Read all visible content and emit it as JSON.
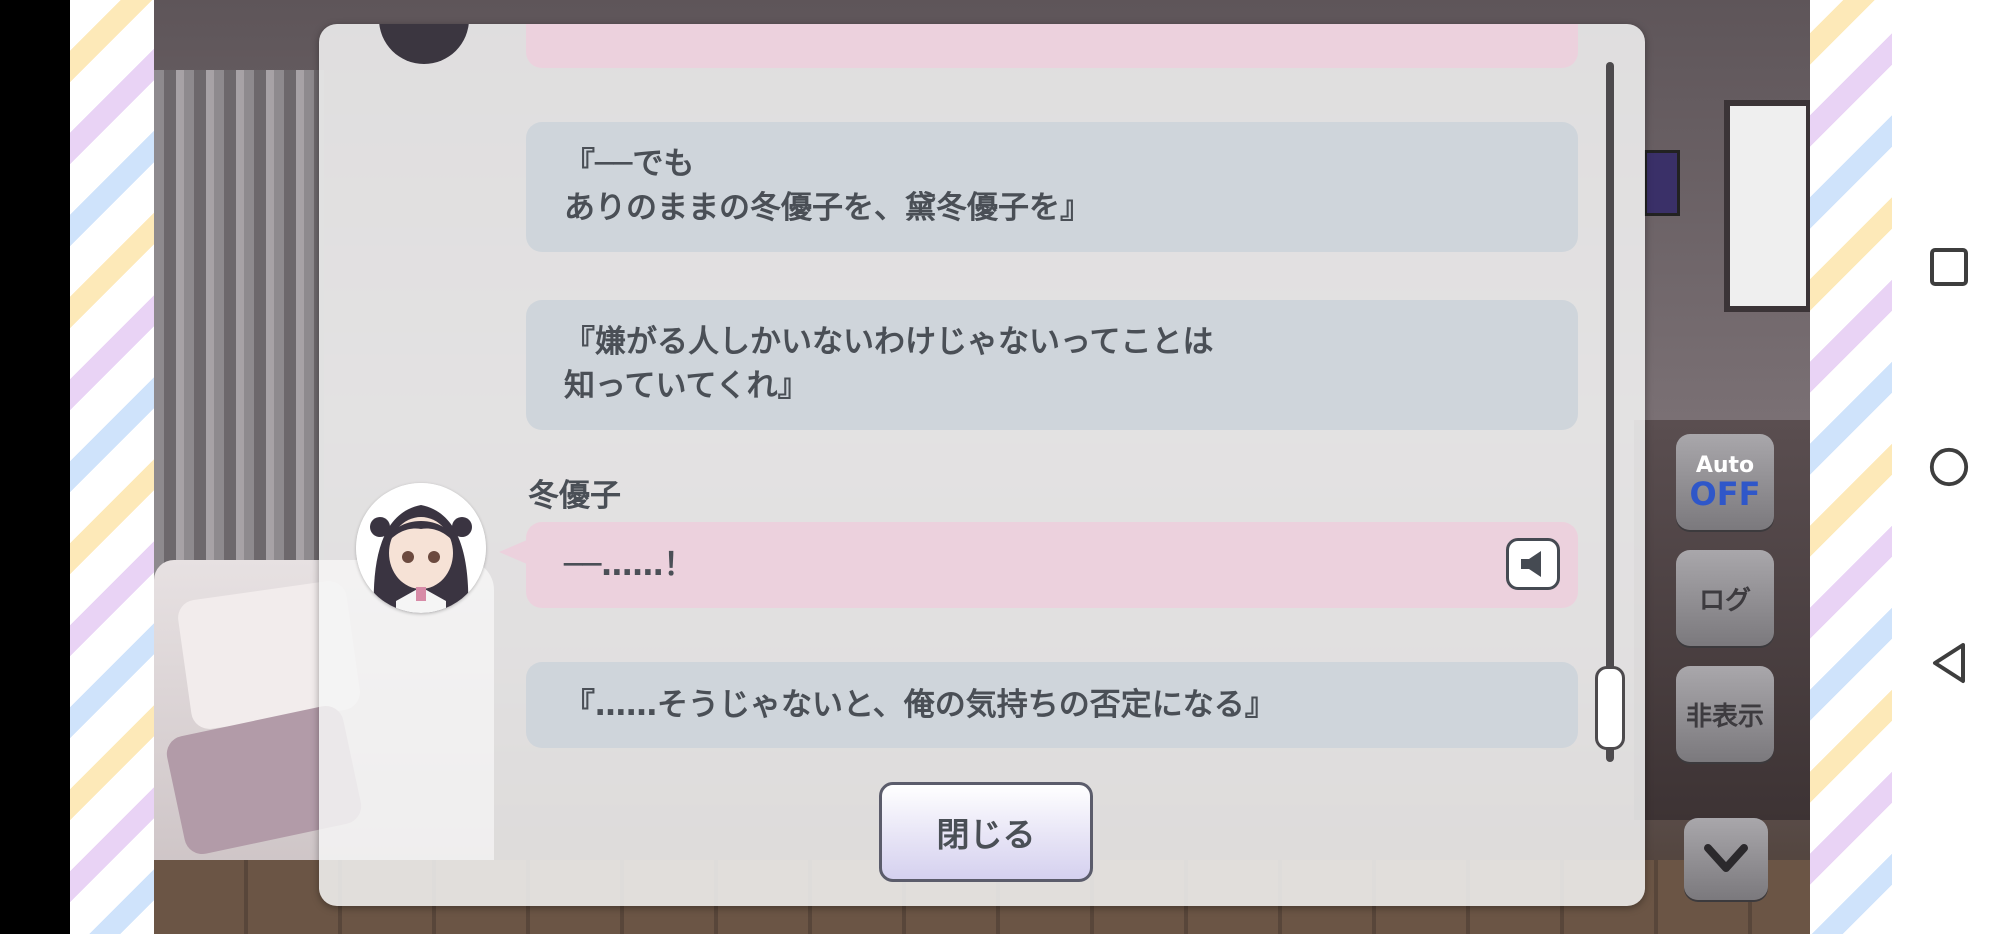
{
  "dialog_log": {
    "messages": [
      {
        "speaker": "",
        "lines": [
          "『──でも",
          "ありのままの冬優子を、黛冬優子を』"
        ]
      },
      {
        "speaker": "",
        "lines": [
          "『嫌がる人しかいないわけじゃないってことは",
          "知っていてくれ』"
        ]
      },
      {
        "speaker": "冬優子",
        "lines": [
          "──……！"
        ]
      },
      {
        "speaker": "",
        "lines": [
          "『……そうじゃないと、俺の気持ちの否定になる』"
        ]
      }
    ],
    "close_label": "閉じる"
  },
  "side_controls": {
    "auto_label": "Auto",
    "auto_state": "OFF",
    "log_label": "ログ",
    "hide_label": "非表示"
  },
  "colors": {
    "gray_bubble": "#cfd5db",
    "pink_bubble": "#ecd1dd",
    "auto_off_color": "#2f57c9"
  }
}
